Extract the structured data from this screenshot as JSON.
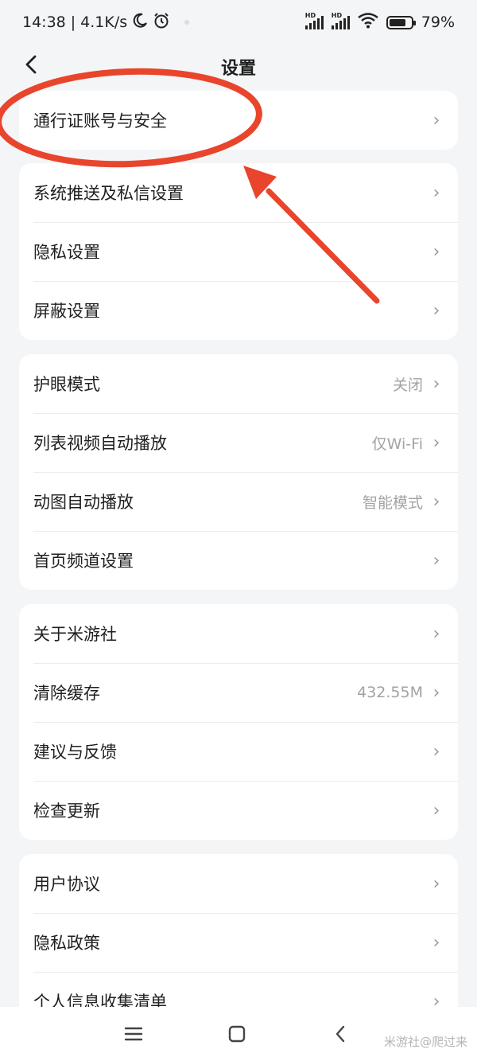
{
  "status_bar": {
    "time": "14:38",
    "speed": "4.1K/s",
    "battery": "79%",
    "battery_level": 0.79,
    "icons": [
      "moon-icon",
      "alarm-icon",
      "signal-icon",
      "wifi-icon",
      "battery-icon"
    ],
    "hd_label_1": "HD",
    "hd_label_2": "HD"
  },
  "header": {
    "title": "设置",
    "back_icon": "chevron-left-icon"
  },
  "groups": [
    {
      "items": [
        {
          "label": "通行证账号与安全",
          "value": ""
        }
      ]
    },
    {
      "items": [
        {
          "label": "系统推送及私信设置",
          "value": ""
        },
        {
          "label": "隐私设置",
          "value": ""
        },
        {
          "label": "屏蔽设置",
          "value": ""
        }
      ]
    },
    {
      "items": [
        {
          "label": "护眼模式",
          "value": "关闭"
        },
        {
          "label": "列表视频自动播放",
          "value": "仅Wi-Fi"
        },
        {
          "label": "动图自动播放",
          "value": "智能模式"
        },
        {
          "label": "首页频道设置",
          "value": ""
        }
      ]
    },
    {
      "items": [
        {
          "label": "关于米游社",
          "value": ""
        },
        {
          "label": "清除缓存",
          "value": "432.55M"
        },
        {
          "label": "建议与反馈",
          "value": ""
        },
        {
          "label": "检查更新",
          "value": ""
        }
      ]
    },
    {
      "items": [
        {
          "label": "用户协议",
          "value": ""
        },
        {
          "label": "隐私政策",
          "value": ""
        },
        {
          "label": "个人信息收集清单",
          "value": ""
        }
      ]
    }
  ],
  "annotation": {
    "color": "#e8452c",
    "shapes": [
      "ellipse-highlight",
      "arrow"
    ]
  },
  "system_nav": {
    "icons": [
      "menu-icon",
      "home-icon",
      "back-icon"
    ]
  },
  "watermark": "米游社@爬过来",
  "colors": {
    "background": "#f4f5f7",
    "card": "#ffffff",
    "value_text": "#a3a3a3",
    "chevron": "#9a9a9a"
  }
}
